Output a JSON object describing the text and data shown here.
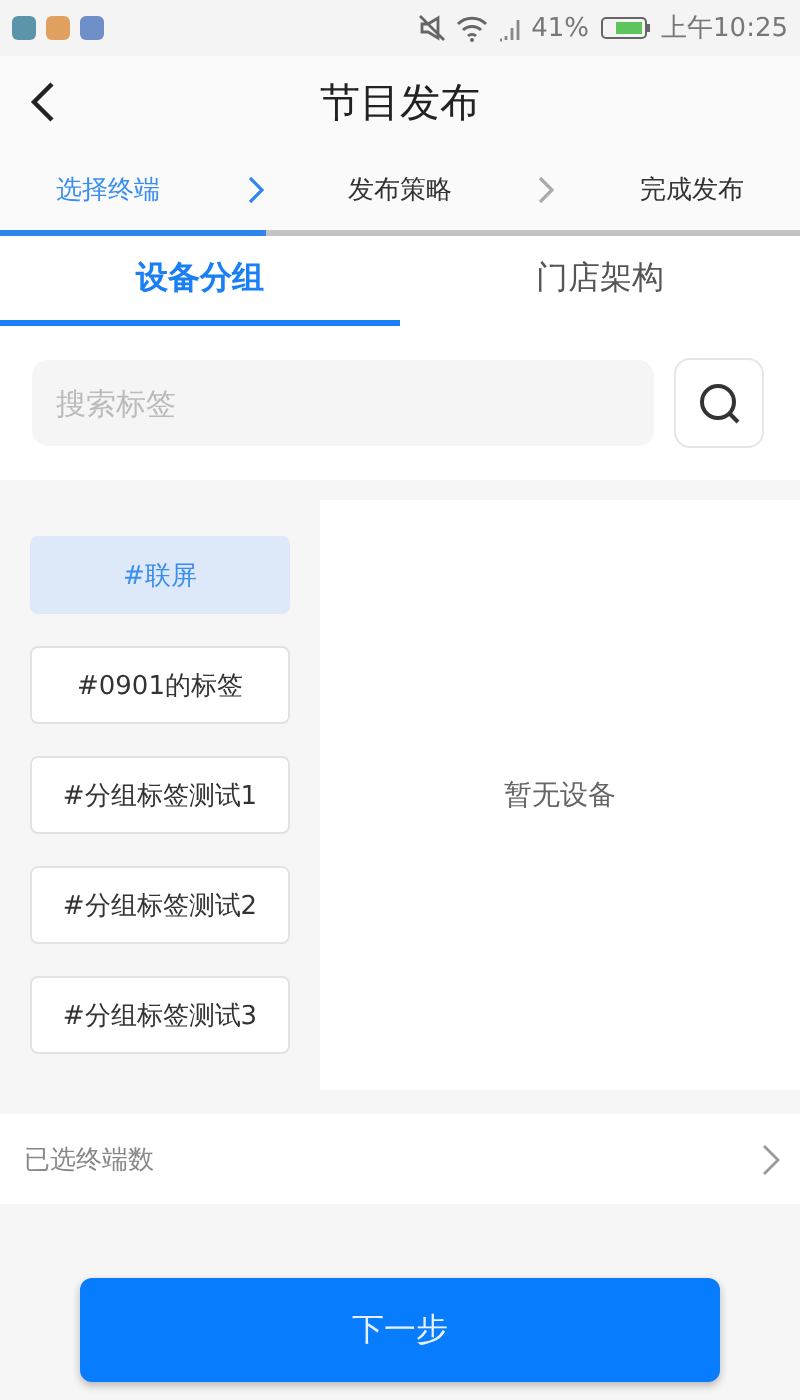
{
  "status_bar": {
    "battery_text": "41%",
    "time": "上午10:25"
  },
  "header": {
    "title": "节目发布"
  },
  "steps": [
    {
      "label": "选择终端",
      "selected": true
    },
    {
      "label": "发布策略",
      "selected": false
    },
    {
      "label": "完成发布",
      "selected": false
    }
  ],
  "progress": {
    "level": 0.333
  },
  "tabs": [
    {
      "label": "设备分组",
      "selected": true
    },
    {
      "label": "门店架构",
      "selected": false
    }
  ],
  "search": {
    "placeholder": "搜索标签"
  },
  "tags": [
    {
      "label": "#联屏",
      "selected": true
    },
    {
      "label": "#0901的标签",
      "selected": false
    },
    {
      "label": "#分组标签测试1",
      "selected": false
    },
    {
      "label": "#分组标签测试2",
      "selected": false
    },
    {
      "label": "#分组标签测试3",
      "selected": false
    }
  ],
  "device_panel": {
    "empty_text": "暂无设备"
  },
  "selected_row": {
    "label": "已选终端数"
  },
  "next_button": {
    "label": "下一步"
  }
}
